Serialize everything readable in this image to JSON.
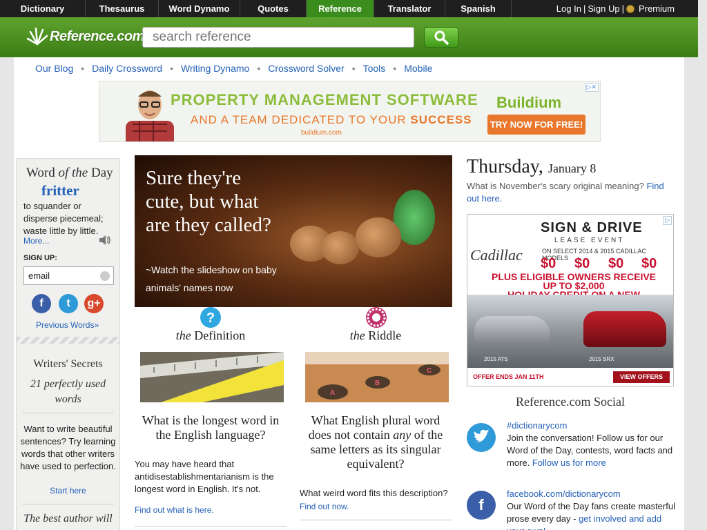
{
  "topnav": {
    "tabs": [
      "Dictionary",
      "Thesaurus",
      "Word Dynamo",
      "Quotes",
      "Reference",
      "Translator",
      "Spanish"
    ],
    "active": "Reference",
    "login": "Log In",
    "signup": "Sign Up",
    "premium": "Premium"
  },
  "header": {
    "logo_text": "Reference.com",
    "search_placeholder": "search reference"
  },
  "sublinks": [
    "Our Blog",
    "Daily Crossword",
    "Writing Dynamo",
    "Crossword Solver",
    "Tools",
    "Mobile"
  ],
  "ad_banner": {
    "line1": "PROPERTY MANAGEMENT SOFTWARE",
    "line2a": "AND A TEAM DEDICATED TO YOUR",
    "line2b": "SUCCESS",
    "url": "buildium.com",
    "brand": "Buildium",
    "cta": "TRY NOW FOR FREE!"
  },
  "sidebar": {
    "wotd_pre": "Word",
    "wotd_of": "of the",
    "wotd_post": "Day",
    "word": "fritter",
    "definition": "to squander or disperse piecemeal; waste little by little.",
    "more": "More...",
    "signup_label": "SIGN UP:",
    "email_value": "email",
    "previous": "Previous Words",
    "writers_title": "Writers' Secrets",
    "writers_sub": "21 perfectly used words",
    "writers_text": "Want to write beautiful sentences? Try learning words that other writers have used to perfection.",
    "start_here": "Start here",
    "best_author": "The best author will"
  },
  "hero": {
    "caption": "Sure they're cute, but what are they called?",
    "sub": "~Watch the slideshow on baby animals' names now"
  },
  "definition_col": {
    "heading_the": "the",
    "heading": "Definition",
    "question": "What is the longest word in the English language?",
    "text": "You may have heard that antidisestablishmentarianism is the longest word in English. It's not.",
    "link": "Find out what is here."
  },
  "riddle_col": {
    "heading_the": "the",
    "heading": "Riddle",
    "question_a": "What English plural word does not contain",
    "question_any": "any",
    "question_b": "of the same letters as its singular equivalent?",
    "text": "What weird word fits this description?",
    "link": "Find out now."
  },
  "right": {
    "day": "Thursday,",
    "date": "January 8",
    "teaser": "What is November's scary original meaning?",
    "teaser_link": "Find out here.",
    "social_title": "Reference.com Social",
    "twitter_handle": "#dictionarycom",
    "twitter_text": "Join the conversation! Follow us for our Word of the Day, contests, word facts and more.",
    "twitter_link": "Follow us for more",
    "fb_handle": "facebook.com/dictionarycom",
    "fb_text": "Our Word of the Day fans create masterful prose every day -",
    "fb_link": "get involved and add your own!"
  },
  "cadillac_ad": {
    "brand": "Cadillac",
    "headline": "SIGN & DRIVE",
    "event": "LEASE EVENT",
    "select": "ON SELECT 2014 & 2015 CADILLAC MODELS",
    "plus_line1": "PLUS ELIGIBLE OWNERS RECEIVE UP TO $2,000",
    "plus_line2": "HOLIDAY CREDIT ON A NEW CADILLAC.",
    "car1": "2015 ATS",
    "car2": "2015 SRX",
    "offer": "OFFER ENDS JAN 11TH",
    "cta": "VIEW OFFERS"
  }
}
